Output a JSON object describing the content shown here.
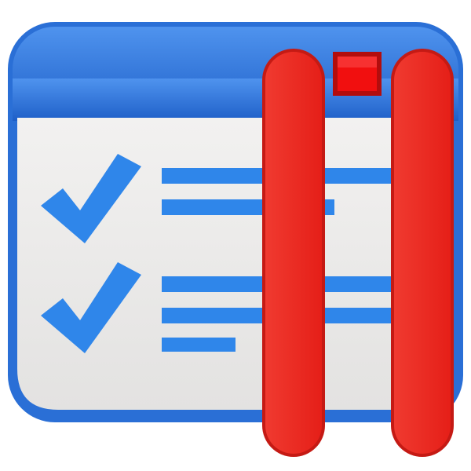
{
  "icon": {
    "name": "checklist-pause-icon",
    "colors": {
      "window_border": "#2a6fd6",
      "titlebar_top": "#3f84e6",
      "titlebar_bottom": "#1f5fc6",
      "content_bg": "#ecebea",
      "checkmark": "#2f86ea",
      "lines": "#2f86ea",
      "close_button": "#f10f0f",
      "pause_bars": "#ee2a22"
    },
    "glyphs": [
      "checkmark-icon",
      "text-lines",
      "pause-icon",
      "window-close-icon"
    ]
  }
}
